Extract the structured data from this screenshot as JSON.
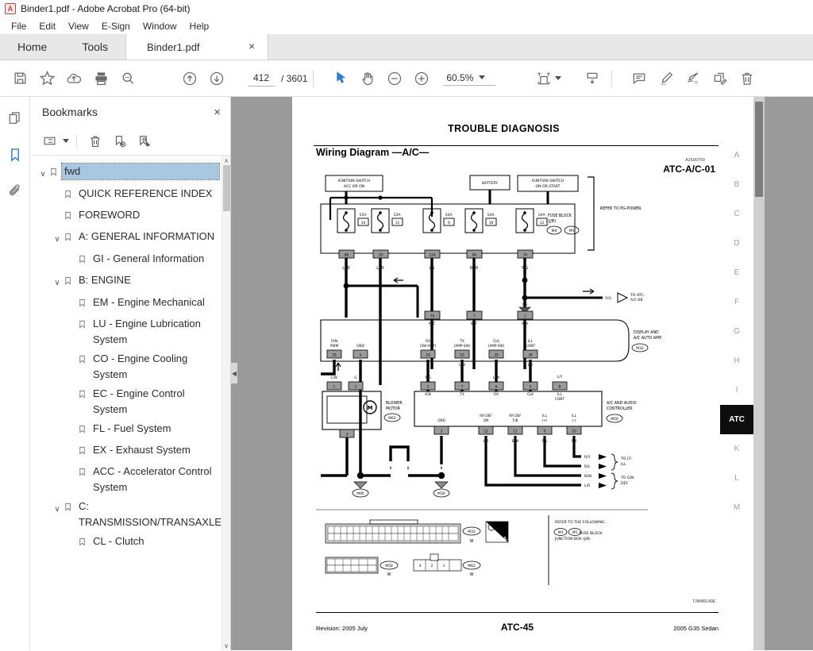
{
  "window": {
    "title": "Binder1.pdf - Adobe Acrobat Pro (64-bit)",
    "logo_letter": "A"
  },
  "menu": {
    "items": [
      {
        "label": "File"
      },
      {
        "label": "Edit"
      },
      {
        "label": "View"
      },
      {
        "label": "E-Sign"
      },
      {
        "label": "Window"
      },
      {
        "label": "Help"
      }
    ]
  },
  "tabs": {
    "home_label": "Home",
    "tools_label": "Tools",
    "document_label": "Binder1.pdf",
    "close_glyph": "×"
  },
  "toolbar": {
    "save_icon": "save-icon",
    "star_icon": "star-icon",
    "cloud_upload_icon": "cloud-upload-icon",
    "print_icon": "print-icon",
    "search_icon": "search-icon",
    "previous_page_icon": "arrow-up-circle-icon",
    "next_page_icon": "arrow-down-circle-icon",
    "page_current": "412",
    "page_total": "/ 3601",
    "select_tool_icon": "cursor-arrow-icon",
    "hand_tool_icon": "hand-icon",
    "zoom_out_icon": "minus-circle-icon",
    "zoom_in_icon": "plus-circle-icon",
    "zoom_level": "60.5%",
    "fit_page_icon": "fit-page-icon",
    "scroll_mode_icon": "page-down-icon",
    "comment_icon": "comment-icon",
    "highlight_icon": "highlight-pen-icon",
    "sign_icon": "sign-icon",
    "stamp_icon": "stamp-edit-icon",
    "delete_icon": "trash-icon"
  },
  "rail": {
    "thumbnails_icon": "page-thumbnails-icon",
    "bookmarks_icon": "bookmark-icon",
    "attachments_icon": "paperclip-icon"
  },
  "bookmarks_panel": {
    "title": "Bookmarks",
    "close_glyph": "×",
    "options_icon": "list-options-icon",
    "delete_icon": "trash-icon",
    "new_bookmark_icon": "new-bookmark-icon",
    "locate_bookmark_icon": "locate-bookmark-icon",
    "scroll_up_glyph": "∧",
    "scroll_down_glyph": "∨",
    "items": [
      {
        "label": "fwd",
        "indent": 0,
        "twisty": "∨",
        "selected": true
      },
      {
        "label": "QUICK REFERENCE INDEX",
        "indent": 1,
        "twisty": "",
        "selected": false
      },
      {
        "label": "FOREWORD",
        "indent": 1,
        "twisty": "",
        "selected": false
      },
      {
        "label": "A: GENERAL INFORMATION",
        "indent": 1,
        "twisty": "∨",
        "selected": false
      },
      {
        "label": "GI - General Information",
        "indent": 2,
        "twisty": "",
        "selected": false
      },
      {
        "label": "B: ENGINE",
        "indent": 1,
        "twisty": "∨",
        "selected": false
      },
      {
        "label": "EM - Engine Mechanical",
        "indent": 2,
        "twisty": "",
        "selected": false
      },
      {
        "label": "LU - Engine Lubrication System",
        "indent": 2,
        "twisty": "",
        "selected": false
      },
      {
        "label": "CO - Engine Cooling System",
        "indent": 2,
        "twisty": "",
        "selected": false
      },
      {
        "label": "EC - Engine Control System",
        "indent": 2,
        "twisty": "",
        "selected": false
      },
      {
        "label": "FL - Fuel System",
        "indent": 2,
        "twisty": "",
        "selected": false
      },
      {
        "label": "EX - Exhaust System",
        "indent": 2,
        "twisty": "",
        "selected": false
      },
      {
        "label": "ACC - Accelerator Control System",
        "indent": 2,
        "twisty": "",
        "selected": false
      },
      {
        "label": "C: TRANSMISSION/TRANSAXLE",
        "indent": 1,
        "twisty": "∨",
        "selected": false
      },
      {
        "label": "CL - Clutch",
        "indent": 2,
        "twisty": "",
        "selected": false
      }
    ]
  },
  "pdf_page": {
    "title": "TROUBLE DIAGNOSIS",
    "section_heading": "Wiring Diagram —A/C—",
    "section_code": "AJS00759",
    "figure_id": "ATC-A/C-01",
    "drawing_code": "TJWM0140E",
    "footer_revision": "Revision: 2005 July",
    "footer_page": "ATC-45",
    "footer_model": "2005 G35 Sedan",
    "diagram": {
      "source_boxes": [
        {
          "line1": "IGNITION SWITCH",
          "line2": "ACC OR ON"
        },
        {
          "line1": "BATTERY",
          "line2": ""
        },
        {
          "line1": "IGNITION SWITCH",
          "line2": "ON OR START"
        }
      ],
      "fuse_block_label_1": "FUSE BLOCK",
      "fuse_block_label_2": "(J/B)",
      "fuse_block_connectors": [
        "M4",
        "M5"
      ],
      "refer_to_pg": "REFER TO PG-POWER.",
      "fuses": [
        {
          "rating": "15A",
          "number": "10",
          "pin": "8B",
          "wire": "L/W"
        },
        {
          "rating": "15A",
          "number": "11",
          "pin": "3D",
          "wire": "L/W"
        },
        {
          "rating": "10A",
          "number": "6",
          "pin": "12A",
          "wire": "LG"
        },
        {
          "rating": "10A",
          "number": "19",
          "pin": "9A",
          "wire": "R/W"
        },
        {
          "rating": "10A",
          "number": "12",
          "pin": "7A",
          "wire": "Y/G"
        }
      ],
      "branch_out": {
        "wire": "Y/G",
        "line1": "TO ATC-",
        "line2": "A/C-08"
      },
      "amp_unit": {
        "name_line1": "DISPLAY AND",
        "name_line2": "A/C AUTO AMP.",
        "connector": "M32",
        "top_pins": [
          {
            "label": "ACC",
            "pin": "70",
            "wire": "LG"
          },
          {
            "label": "BAT",
            "pin": "7",
            "wire": "R/W"
          },
          {
            "label": "IGN",
            "pin": "2",
            "wire": "Y/G"
          }
        ],
        "bottom_pins": [
          {
            "label1": "FAN",
            "label2": "PWM",
            "pin": "25",
            "wire": "G"
          },
          {
            "label1": "GND",
            "label2": "",
            "pin": "5",
            "wire": "B"
          },
          {
            "label1": "RX",
            "label2": "(SW-AMP)",
            "pin": "14",
            "wire": "G"
          },
          {
            "label1": "TX",
            "label2": "(AMP-SW)",
            "pin": "15",
            "wire": "L/W"
          },
          {
            "label1": "CLK",
            "label2": "(AMP-SW)",
            "pin": "35",
            "wire": "Y"
          },
          {
            "label1": "ILL",
            "label2": "CONT",
            "pin": "34",
            "wire": "L/Y"
          }
        ]
      },
      "blower_motor": {
        "name_line1": "BLOWER",
        "name_line2": "MOTOR",
        "connector": "M62",
        "motor_glyph": "M",
        "pins": [
          {
            "pin": "1",
            "wire": "L/W"
          },
          {
            "pin": "2",
            "wire": "G"
          },
          {
            "pin": "3",
            "wire": "B"
          }
        ]
      },
      "controller": {
        "name_line1": "A/C AND AUDIO",
        "name_line2": "CONTROLLER",
        "connector": "M50",
        "top_pins": [
          {
            "label1": "IGN",
            "label2": "",
            "pin": "2",
            "wire": "Y/G"
          },
          {
            "label1": "TX",
            "label2": "",
            "pin": "7",
            "wire": "G"
          },
          {
            "label1": "RX",
            "label2": "",
            "pin": "6",
            "wire": "L/W"
          },
          {
            "label1": "CLK",
            "label2": "",
            "pin": "5",
            "wire": "Y"
          },
          {
            "label1": "ILL",
            "label2": "CONT",
            "pin": "8",
            "wire": "L/Y"
          }
        ],
        "bottom_pins": [
          {
            "label1": "GND",
            "label2": "",
            "pin": "3",
            "wire": "B"
          },
          {
            "label1": "RR DEF",
            "label2": "ON",
            "pin": "12",
            "wire": "L/R"
          },
          {
            "label1": "RR DEF",
            "label2": "F/B",
            "pin": "11",
            "wire": "B/W"
          },
          {
            "label1": "ILL",
            "label2": "(+)",
            "pin": "9",
            "wire": "R/L"
          },
          {
            "label1": "ILL",
            "label2": "(-)",
            "pin": "10",
            "wire": "R/Y"
          }
        ]
      },
      "grounds": [
        "M66",
        "M30"
      ],
      "exits": [
        {
          "wire": "R/Y",
          "line1": "TO LT-",
          "line2": "ILL"
        },
        {
          "wire": "R/L",
          "line1": "",
          "line2": ""
        },
        {
          "wire": "B/W",
          "line1": "TO GW-",
          "line2": "DEF"
        },
        {
          "wire": "L/R",
          "line1": "",
          "line2": ""
        }
      ],
      "connector_views": [
        {
          "connector": "M32",
          "code": "W",
          "hs_badge": "H.S."
        },
        {
          "connector": "M50",
          "code": "W",
          "hs_badge": ""
        },
        {
          "connector": "M62",
          "code": "W",
          "hs_badge": ""
        }
      ],
      "refer_box": {
        "line1": "REFER TO THE FOLLOWING.",
        "connectors": [
          "M4",
          "M5"
        ],
        "line2": "-FUSE BLOCK-",
        "line3": "JUNCTION BOX (J/B)"
      }
    }
  },
  "index_tabs": {
    "items": [
      {
        "label": "A",
        "active": false
      },
      {
        "label": "B",
        "active": false
      },
      {
        "label": "C",
        "active": false
      },
      {
        "label": "D",
        "active": false
      },
      {
        "label": "E",
        "active": false
      },
      {
        "label": "F",
        "active": false
      },
      {
        "label": "G",
        "active": false
      },
      {
        "label": "H",
        "active": false
      },
      {
        "label": "I",
        "active": false
      },
      {
        "label": "ATC",
        "active": true
      },
      {
        "label": "K",
        "active": false
      },
      {
        "label": "L",
        "active": false
      },
      {
        "label": "M",
        "active": false
      }
    ]
  },
  "colors": {
    "accent": "#2b7cd3",
    "selection": "#a8c7e0",
    "viewer_bg": "#9a9a9a",
    "tab_active_bg": "#0d0d0d"
  }
}
